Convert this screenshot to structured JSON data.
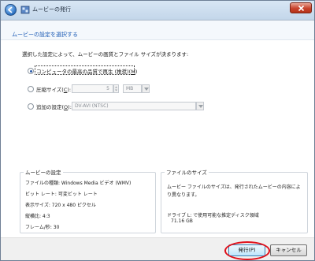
{
  "window": {
    "title": "ムービーの発行",
    "back_icon": "back-arrow-icon",
    "close_icon": "close-x-icon"
  },
  "header": {
    "instruction": "ムービーの設定を選択する"
  },
  "main": {
    "description": "選択した設定によって、ムービーの画質とファイル サイズが決まります:",
    "options": [
      {
        "label": "コンピュータの最高の品質で再生 (推奨)(",
        "underlined": "M",
        "close": ")",
        "checked": true
      },
      {
        "label": "圧縮サイズ(",
        "underlined": "C",
        "close": "):",
        "checked": false,
        "value": "5",
        "unit": "MB"
      },
      {
        "label": "追加の設定(",
        "underlined": "O",
        "close": "):",
        "checked": false,
        "value": "DV-AVI (NTSC)"
      }
    ]
  },
  "movie_settings": {
    "title": "ムービーの設定",
    "lines": [
      "ファイルの種類: Windows Media ビデオ (WMV)",
      "ビット レート: 可変ビット レート",
      "表示サイズ: 720 x 480 ピクセル",
      "縦横比: 4:3",
      "フレーム/秒: 30"
    ]
  },
  "file_size": {
    "title": "ファイルのサイズ",
    "text_lines": [
      "ムービー ファイルのサイズは、発行されたムービーの内容によ",
      "り異なります。"
    ],
    "drive_line": "ドライブ L: で使用可能な推定ディスク領域",
    "drive_space": "71.16 GB"
  },
  "footer": {
    "publish": "発行(P)",
    "cancel": "キャンセル"
  },
  "colors": {
    "instruction": "#1c5bb5",
    "highlight_circle": "#e0101a"
  }
}
